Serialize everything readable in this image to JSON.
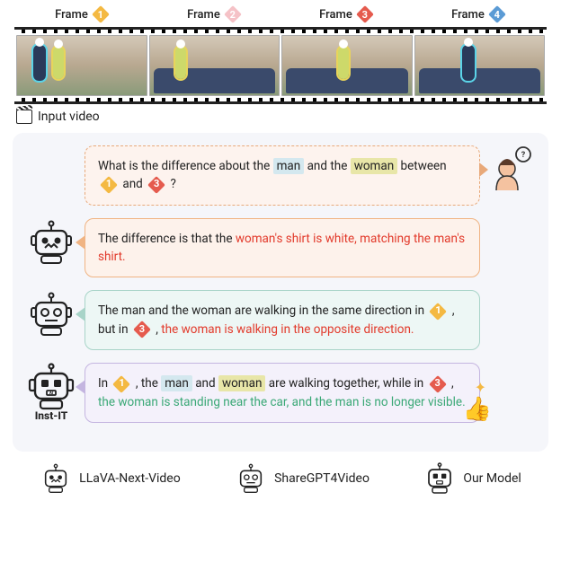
{
  "frames": {
    "labels": [
      "Frame",
      "Frame",
      "Frame",
      "Frame"
    ],
    "numbers": [
      "1",
      "2",
      "3",
      "4"
    ]
  },
  "input_label": "Input video",
  "question": {
    "parts": [
      "What is the difference about the ",
      "man",
      " and the ",
      "woman",
      " between ",
      " and ",
      " ?"
    ],
    "d1": "1",
    "d3": "3"
  },
  "llava": {
    "parts": [
      "The difference is that the ",
      "woman's shirt is white, matching the man's shirt."
    ]
  },
  "sharegpt": {
    "parts": [
      "The man and the woman are walking in the same direction in ",
      " , but in ",
      " , ",
      "the woman is walking in the opposite direction."
    ],
    "d1": "1",
    "d3": "3"
  },
  "ours": {
    "parts": [
      "In ",
      " , the ",
      "man",
      " and ",
      "woman",
      " are walking together, while in ",
      " , ",
      "the woman is standing near the car, and the man is no longer visible."
    ],
    "d1": "1",
    "d3": "3"
  },
  "instit_label": "Inst-IT",
  "legend": {
    "llava": "LLaVA-Next-Video",
    "sharegpt": "ShareGPT4Video",
    "ours": "Our Model"
  }
}
